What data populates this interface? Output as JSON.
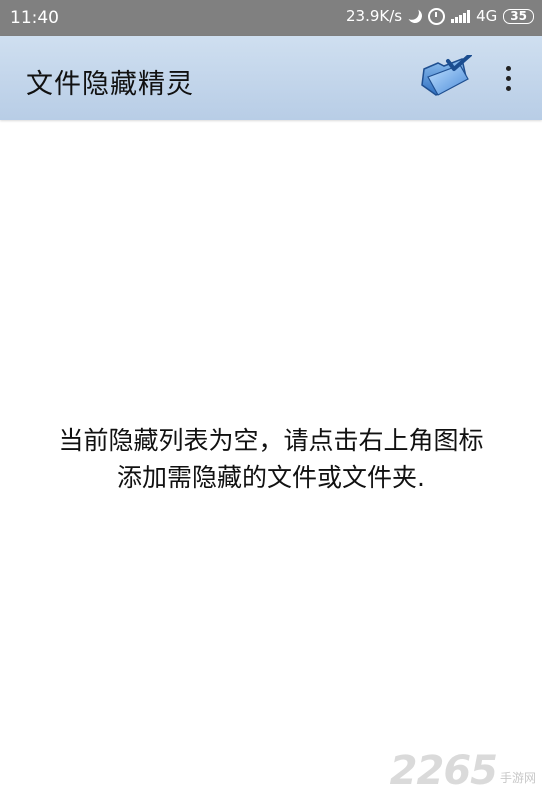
{
  "status_bar": {
    "time": "11:40",
    "speed": "23.9K/s",
    "network": "4G",
    "battery": "35"
  },
  "app_bar": {
    "title": "文件隐藏精灵"
  },
  "content": {
    "empty_line1": "当前隐藏列表为空，请点击右上角图标",
    "empty_line2": "添加需隐藏的文件或文件夹."
  },
  "watermark": {
    "number": "2265",
    "text": "手游网"
  }
}
